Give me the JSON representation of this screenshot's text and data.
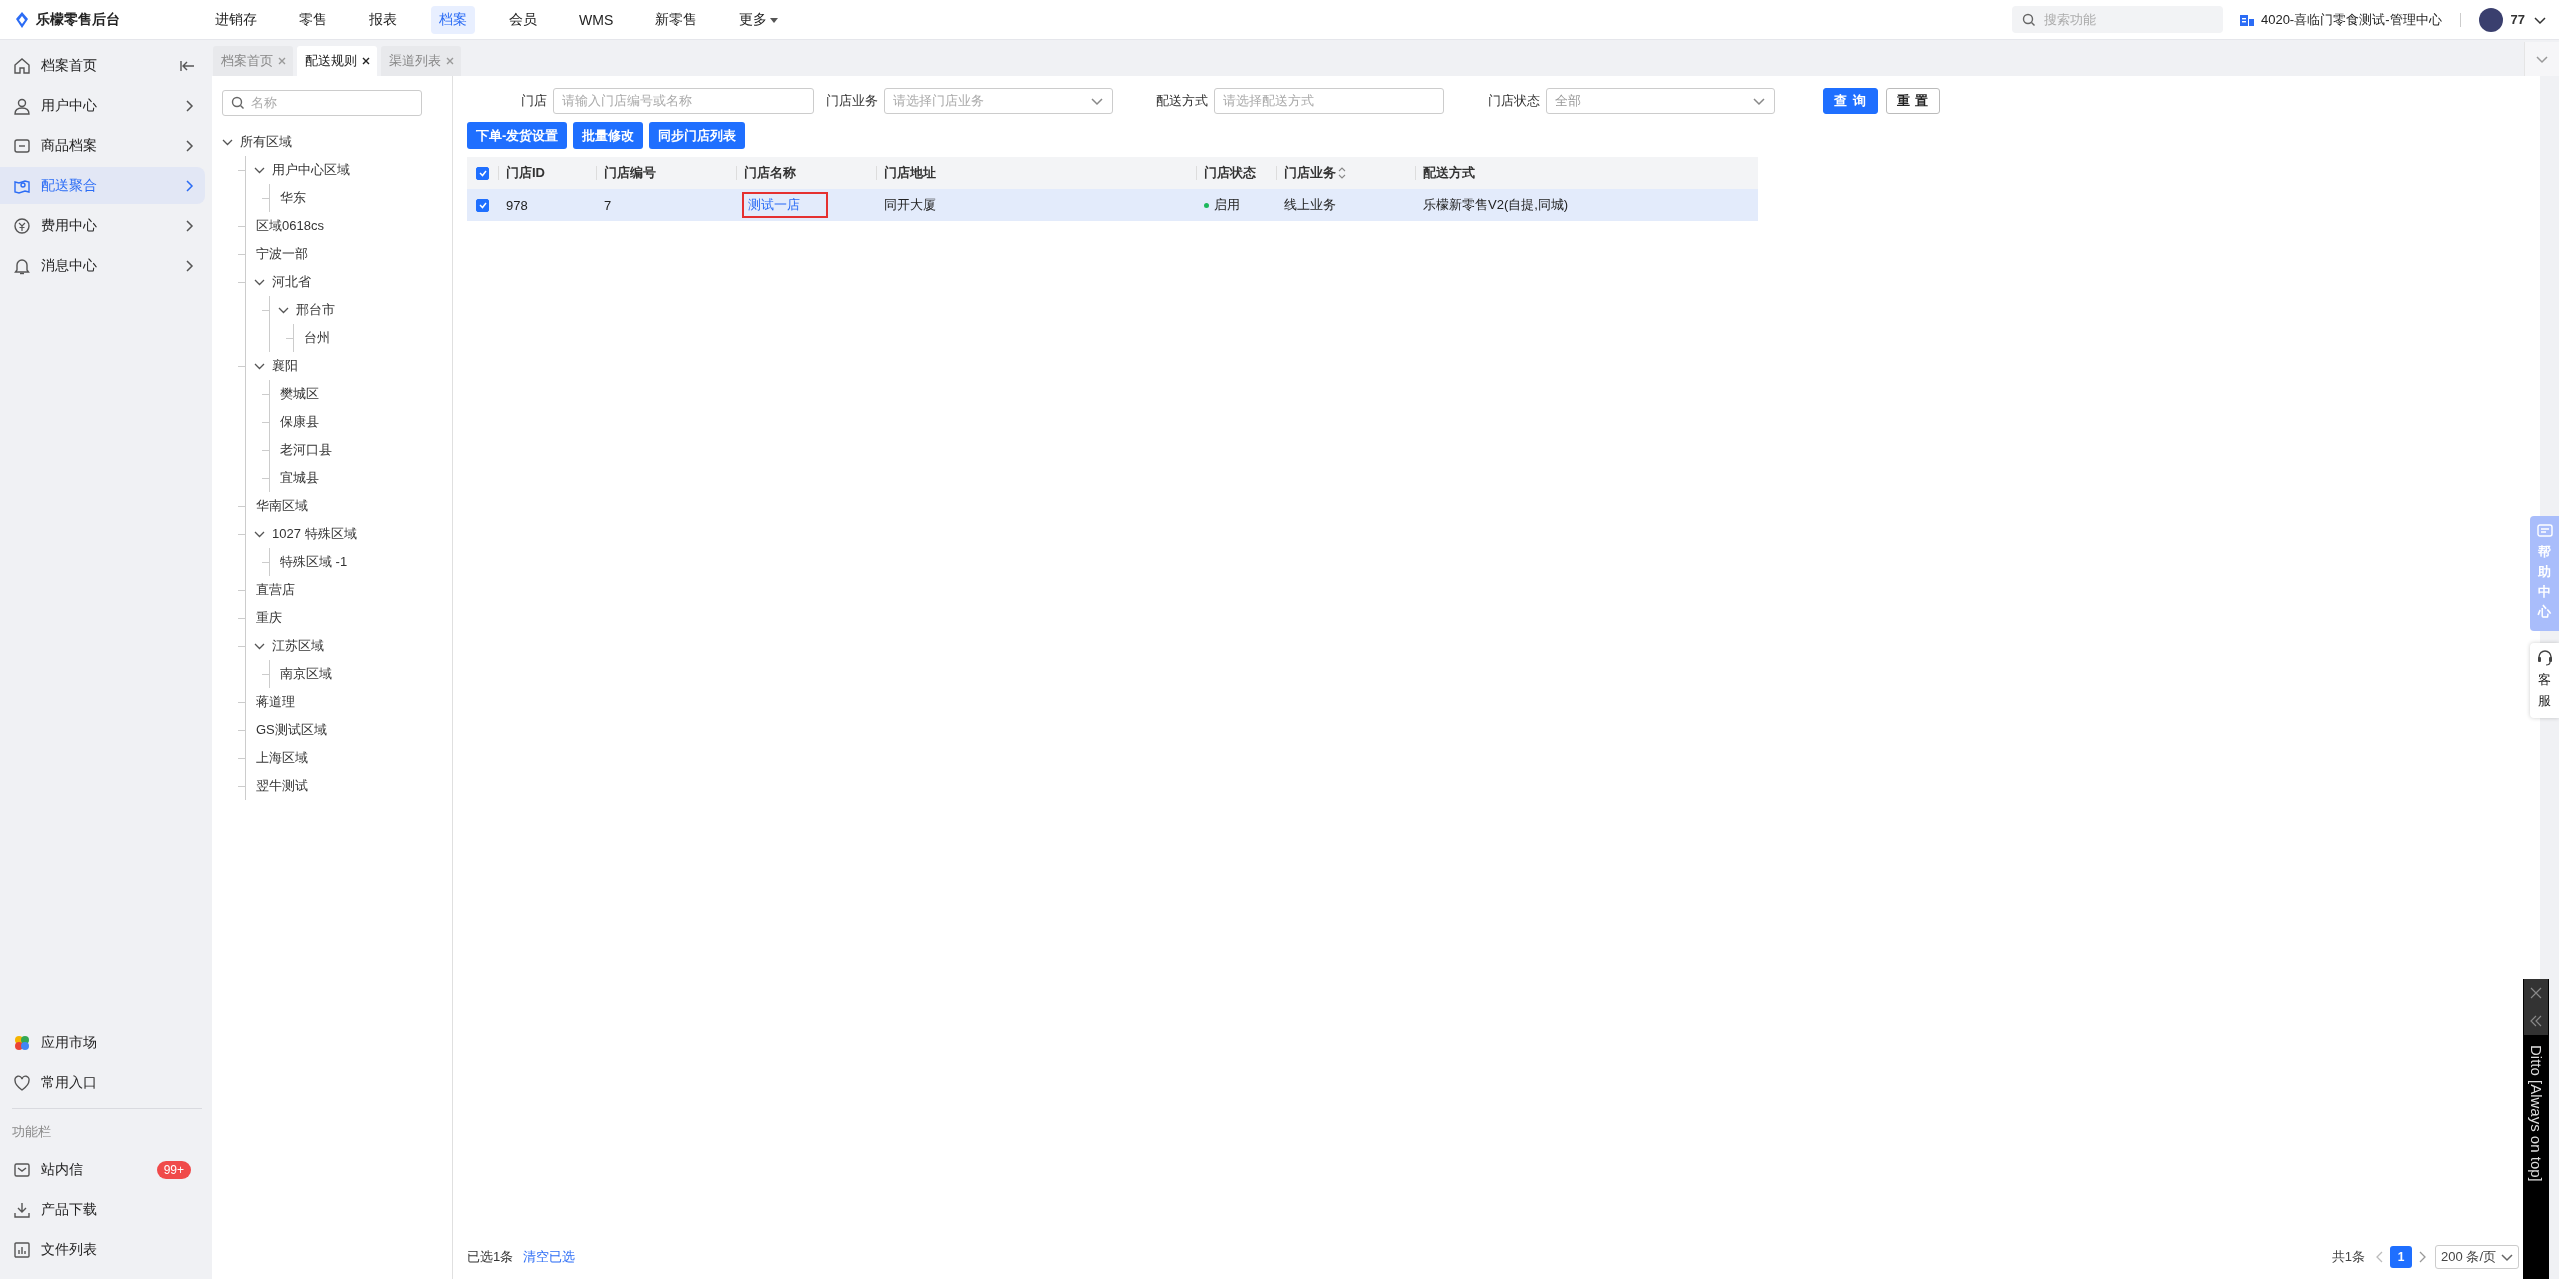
{
  "topbar": {
    "brand": "乐檬零售后台",
    "nav": [
      {
        "label": "进销存",
        "selected": false,
        "dropdown": false
      },
      {
        "label": "零售",
        "selected": false,
        "dropdown": false
      },
      {
        "label": "报表",
        "selected": false,
        "dropdown": false
      },
      {
        "label": "档案",
        "selected": true,
        "dropdown": false
      },
      {
        "label": "会员",
        "selected": false,
        "dropdown": false
      },
      {
        "label": "WMS",
        "selected": false,
        "dropdown": false
      },
      {
        "label": "新零售",
        "selected": false,
        "dropdown": false
      },
      {
        "label": "更多",
        "selected": false,
        "dropdown": true
      }
    ],
    "search": {
      "placeholder": "搜索功能"
    },
    "org": "4020-喜临门零食测试-管理中心",
    "user": "77"
  },
  "tabs": [
    {
      "label": "档案首页",
      "selected": false
    },
    {
      "label": "配送规则",
      "selected": true
    },
    {
      "label": "渠道列表",
      "selected": false
    }
  ],
  "sidebar": {
    "items": [
      {
        "label": "档案首页",
        "kind": "home",
        "selected": false
      },
      {
        "label": "用户中心",
        "kind": "menu",
        "selected": false
      },
      {
        "label": "商品档案",
        "kind": "menu",
        "selected": false
      },
      {
        "label": "配送聚合",
        "kind": "menu",
        "selected": true
      },
      {
        "label": "费用中心",
        "kind": "menu",
        "selected": false
      },
      {
        "label": "消息中心",
        "kind": "menu",
        "selected": false
      }
    ],
    "bottom_items": [
      {
        "label": "应用市场"
      },
      {
        "label": "常用入口"
      }
    ],
    "section_title": "功能栏",
    "tools": [
      {
        "label": "站内信",
        "badge": "99+"
      },
      {
        "label": "产品下载"
      },
      {
        "label": "文件列表"
      }
    ]
  },
  "tree": {
    "search": {
      "placeholder": "名称"
    },
    "nodes": [
      {
        "label": "所有区域",
        "expanded": true,
        "children": [
          {
            "label": "用户中心区域",
            "expanded": true,
            "children": [
              {
                "label": "华东"
              }
            ]
          },
          {
            "label": "区域0618cs"
          },
          {
            "label": "宁波一部"
          },
          {
            "label": "河北省",
            "expanded": true,
            "children": [
              {
                "label": "邢台市",
                "expanded": true,
                "children": [
                  {
                    "label": "台州"
                  }
                ]
              }
            ]
          },
          {
            "label": "襄阳",
            "expanded": true,
            "children": [
              {
                "label": "樊城区"
              },
              {
                "label": "保康县"
              },
              {
                "label": "老河口县"
              },
              {
                "label": "宜城县"
              }
            ]
          },
          {
            "label": "华南区域"
          },
          {
            "label": "1027 特殊区域",
            "expanded": true,
            "children": [
              {
                "label": "特殊区域 -1"
              }
            ]
          },
          {
            "label": "直营店"
          },
          {
            "label": "重庆"
          },
          {
            "label": "江苏区域",
            "expanded": true,
            "children": [
              {
                "label": "南京区域"
              }
            ]
          },
          {
            "label": "蒋道理"
          },
          {
            "label": "GS测试区域"
          },
          {
            "label": "上海区域"
          },
          {
            "label": "翌牛测试"
          }
        ]
      }
    ]
  },
  "filters": [
    {
      "label": "门店",
      "kind": "input",
      "placeholder": "请输入门店编号或名称"
    },
    {
      "label": "门店业务",
      "kind": "select",
      "placeholder": "请选择门店业务"
    },
    {
      "label": "配送方式",
      "kind": "input",
      "placeholder": "请选择配送方式"
    },
    {
      "label": "门店状态",
      "kind": "select",
      "value": "全部"
    }
  ],
  "filter_buttons": [
    {
      "label": "查 询",
      "kind": "primary"
    },
    {
      "label": "重 置",
      "kind": "default"
    }
  ],
  "actions": [
    "下单-发货设置",
    "批量修改",
    "同步门店列表"
  ],
  "table": {
    "all_checked": true,
    "columns": [
      {
        "label": "门店ID",
        "sortable": false
      },
      {
        "label": "门店编号",
        "sortable": false
      },
      {
        "label": "门店名称",
        "sortable": false
      },
      {
        "label": "门店地址",
        "sortable": false
      },
      {
        "label": "门店状态",
        "sortable": false
      },
      {
        "label": "门店业务",
        "sortable": true
      },
      {
        "label": "配送方式",
        "sortable": false
      }
    ],
    "rows": [
      {
        "selected": true,
        "id": "978",
        "code": "7",
        "name": "测试一店",
        "name_highlighted": true,
        "address": "同开大厦",
        "status": "启用",
        "business": "线上业务",
        "delivery": "乐檬新零售V2(自提,同城)"
      }
    ]
  },
  "footer": {
    "selected_text": "已选1条",
    "clear_link": "清空已选",
    "total": "共1条",
    "pages": [
      {
        "label": "1",
        "selected": true
      }
    ],
    "page_size": "200 条/页"
  },
  "float": {
    "help": "帮助中心",
    "service": "客服"
  },
  "ditto": {
    "title": "Ditto [Always on top]"
  }
}
